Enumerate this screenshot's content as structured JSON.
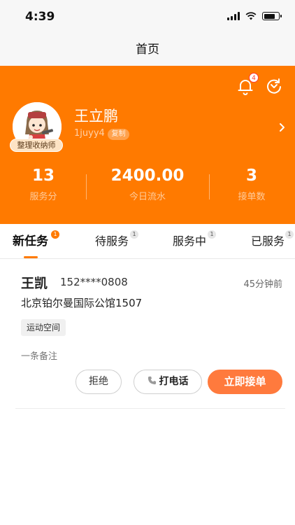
{
  "status_bar": {
    "time": "4:39"
  },
  "nav": {
    "title": "首页"
  },
  "profile": {
    "notification_count": "4",
    "name": "王立鹏",
    "user_id": "1juyy4",
    "copy_label": "复制",
    "role_badge": "整理收纳师",
    "stats": [
      {
        "value": "13",
        "label": "服务分"
      },
      {
        "value": "2400.00",
        "label": "今日流水"
      },
      {
        "value": "3",
        "label": "接单数"
      }
    ]
  },
  "tabs": [
    {
      "label": "新任务",
      "badge": "1",
      "active": true
    },
    {
      "label": "待服务",
      "badge": "1",
      "active": false
    },
    {
      "label": "服务中",
      "badge": "1",
      "active": false
    },
    {
      "label": "已服务",
      "badge": "1",
      "active": false
    }
  ],
  "task": {
    "customer_name": "王凯",
    "phone": "152****0808",
    "time_ago": "45分钟前",
    "address": "北京铂尔曼国际公馆1507",
    "tag": "运动空间",
    "remark": "一条备注",
    "reject_label": "拒绝",
    "call_label": "打电话",
    "accept_label": "立即接单"
  },
  "colors": {
    "brand": "#ff7a00",
    "accent_button": "#ff7a3d"
  }
}
